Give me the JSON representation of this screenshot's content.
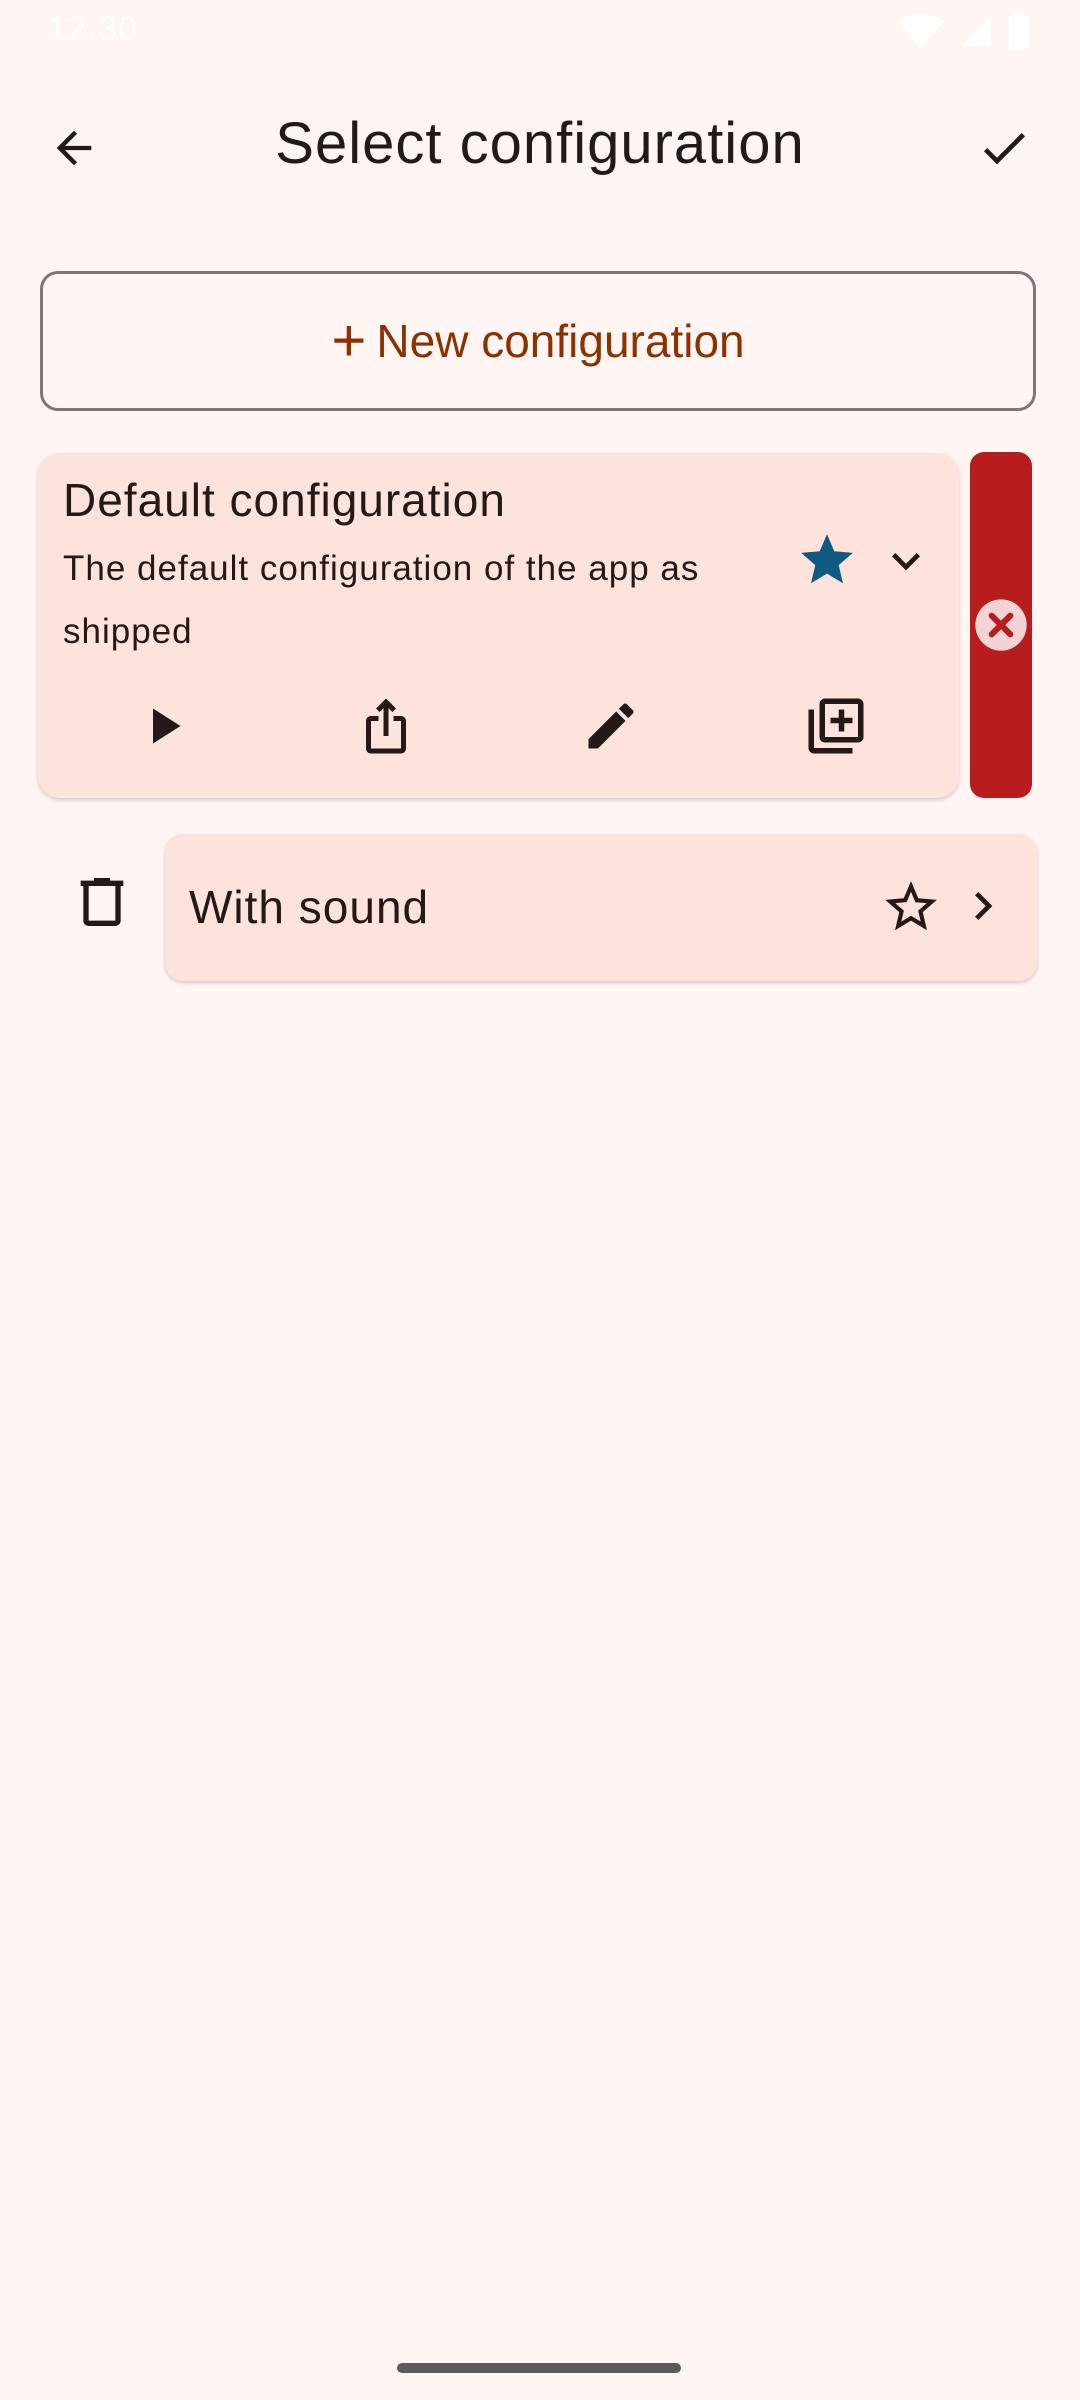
{
  "status_bar": {
    "time": "12:30"
  },
  "app_bar": {
    "title": "Select configuration"
  },
  "new_config": {
    "label": "New configuration"
  },
  "configs": [
    {
      "title": "Default configuration",
      "description": "The default configuration of the app as shipped",
      "favorite": true,
      "expanded": true
    },
    {
      "title": "With sound",
      "favorite": false,
      "expanded": false
    }
  ],
  "colors": {
    "background": "#fff6f4",
    "card": "#fde3dc",
    "accent_text": "#8c3200",
    "star_filled": "#0e5a80",
    "delete": "#b91c1c"
  }
}
